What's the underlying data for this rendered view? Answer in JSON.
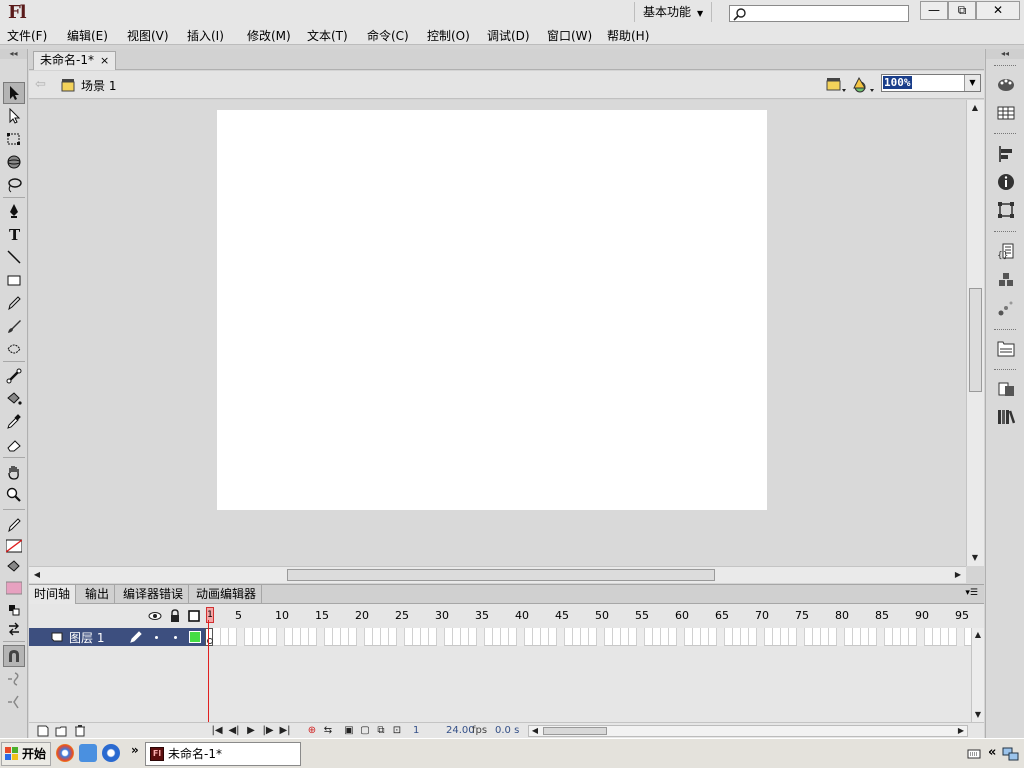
{
  "app": {
    "logo": "Fl",
    "workspace": "基本功能",
    "search_placeholder": ""
  },
  "window_buttons": {
    "minimize": "—",
    "restore": "⧉",
    "close": "✕"
  },
  "menus": [
    "文件(F)",
    "编辑(E)",
    "视图(V)",
    "插入(I)",
    "修改(M)",
    "文本(T)",
    "命令(C)",
    "控制(O)",
    "调试(D)",
    "窗口(W)",
    "帮助(H)"
  ],
  "document": {
    "tab_title": "未命名-1*",
    "tab_close": "×",
    "scene": "场景 1",
    "zoom": "100%"
  },
  "timeline": {
    "tabs": [
      "时间轴",
      "输出",
      "编译器错误",
      "动画编辑器"
    ],
    "active_tab": "时间轴",
    "layer": {
      "name": "图层 1"
    },
    "frame_numbers": [
      "1",
      "5",
      "10",
      "15",
      "20",
      "25",
      "30",
      "35",
      "40",
      "45",
      "50",
      "55",
      "60",
      "65",
      "70",
      "75",
      "80",
      "85",
      "90",
      "95"
    ],
    "current_frame": "1",
    "frame_rate": "24.00",
    "frame_rate_unit": "fps",
    "elapsed_time": "0.0 s"
  },
  "tools": [
    "selection-tool",
    "subselection-tool",
    "free-transform-tool",
    "3d-rotation-tool",
    "lasso-tool",
    "pen-tool",
    "text-tool",
    "line-tool",
    "rectangle-tool",
    "pencil-tool",
    "brush-tool",
    "deco-tool",
    "bone-tool",
    "paint-bucket-tool",
    "eyedropper-tool",
    "eraser-tool",
    "hand-tool",
    "zoom-tool",
    "stroke-color",
    "fill-color",
    "black-white",
    "swap-colors",
    "snap-to-objects",
    "smooth",
    "straighten"
  ],
  "right_panels": [
    "color-panel",
    "swatches-panel",
    "align-panel",
    "info-panel",
    "transform-panel",
    "actions-panel",
    "components-panel",
    "motion-presets-panel",
    "library-panel",
    "project-panel",
    "movie-explorer-panel"
  ],
  "taskbar": {
    "start": "开始",
    "task_title": "未命名-1*"
  },
  "colors": {
    "layer_row": "#3d4f7f",
    "playhead": "#e02020",
    "fill_swatch": "#e7a1c0",
    "zoom_highlight": "#1a3e8a"
  }
}
